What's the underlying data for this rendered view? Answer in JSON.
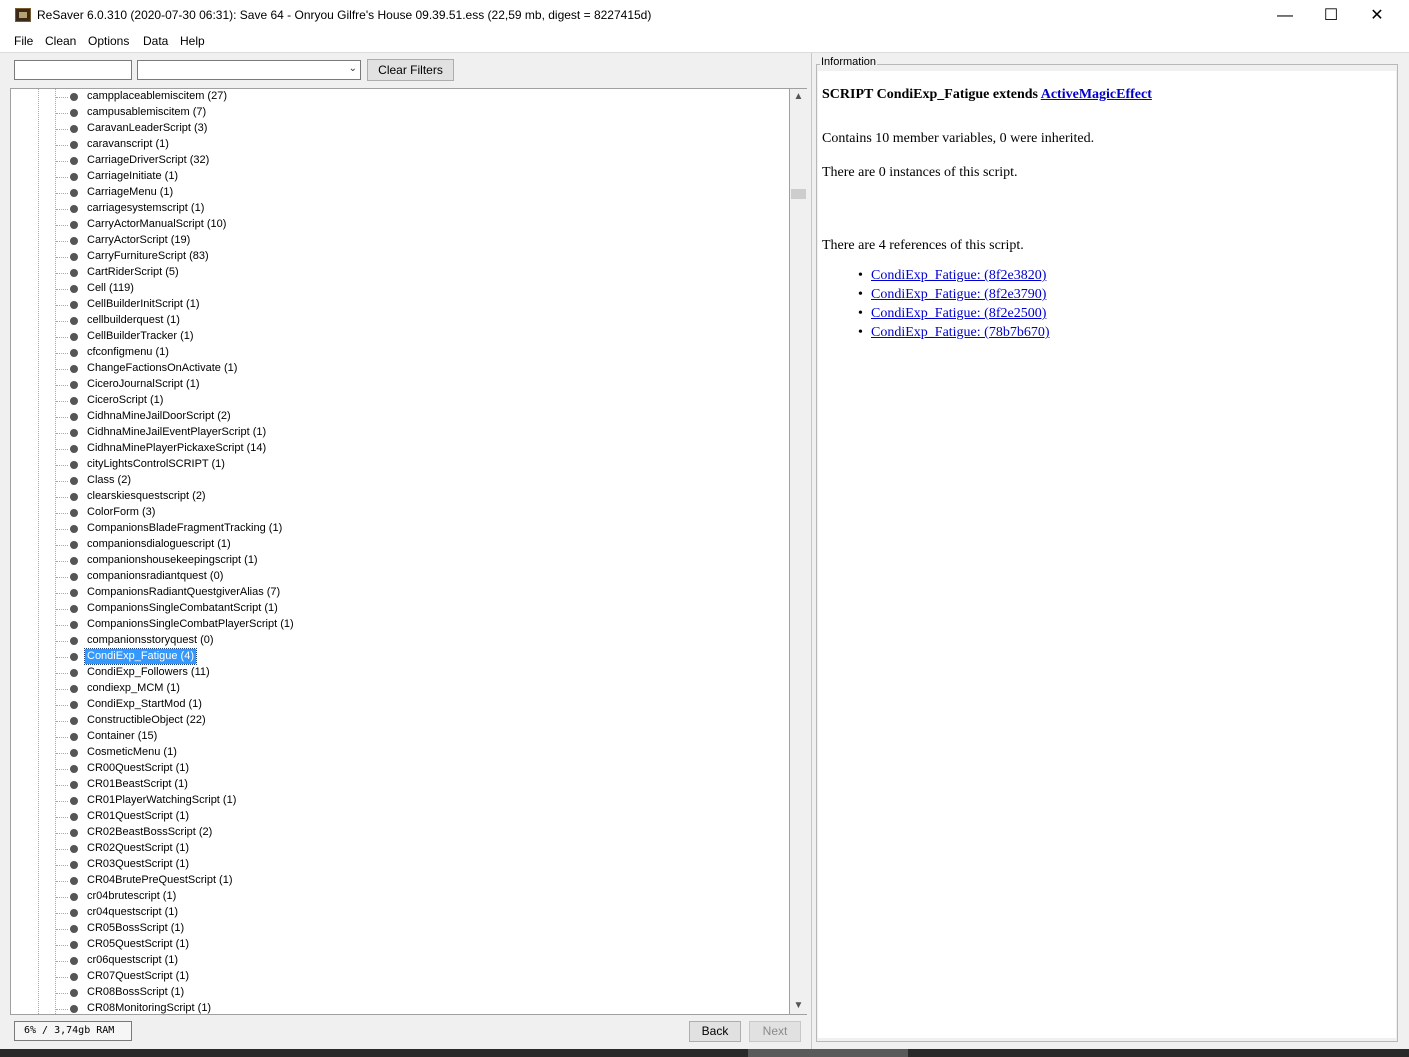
{
  "window": {
    "title": "ReSaver 6.0.310 (2020-07-30 06:31): Save 64 - Onryou  Gilfre's House  09.39.51.ess (22,59 mb, digest = 8227415d)",
    "minimize": "—",
    "maximize": "☐",
    "close": "✕"
  },
  "menu": [
    "File",
    "Clean",
    "Options",
    "Data",
    "Help"
  ],
  "filters": {
    "text_value": "",
    "select_value": "",
    "clear_label": "Clear Filters"
  },
  "tree": {
    "selected_index": 35,
    "items": [
      "campplaceablemiscitem (27)",
      "campusablemiscitem (7)",
      "CaravanLeaderScript (3)",
      "caravanscript (1)",
      "CarriageDriverScript (32)",
      "CarriageInitiate (1)",
      "CarriageMenu (1)",
      "carriagesystemscript (1)",
      "CarryActorManualScript (10)",
      "CarryActorScript (19)",
      "CarryFurnitureScript (83)",
      "CartRiderScript (5)",
      "Cell (119)",
      "CellBuilderInitScript (1)",
      "cellbuilderquest (1)",
      "CellBuilderTracker (1)",
      "cfconfigmenu (1)",
      "ChangeFactionsOnActivate (1)",
      "CiceroJournalScript (1)",
      "CiceroScript (1)",
      "CidhnaMineJailDoorScript (2)",
      "CidhnaMineJailEventPlayerScript (1)",
      "CidhnaMinePlayerPickaxeScript (14)",
      "cityLightsControlSCRIPT (1)",
      "Class (2)",
      "clearskiesquestscript (2)",
      "ColorForm (3)",
      "CompanionsBladeFragmentTracking (1)",
      "companionsdialoguescript (1)",
      "companionshousekeepingscript (1)",
      "companionsradiantquest (0)",
      "CompanionsRadiantQuestgiverAlias (7)",
      "CompanionsSingleCombatantScript (1)",
      "CompanionsSingleCombatPlayerScript (1)",
      "companionsstoryquest (0)",
      "CondiExp_Fatigue (4)",
      "CondiExp_Followers (11)",
      "condiexp_MCM (1)",
      "CondiExp_StartMod (1)",
      "ConstructibleObject (22)",
      "Container (15)",
      "CosmeticMenu (1)",
      "CR00QuestScript (1)",
      "CR01BeastScript (1)",
      "CR01PlayerWatchingScript (1)",
      "CR01QuestScript (1)",
      "CR02BeastBossScript (2)",
      "CR02QuestScript (1)",
      "CR03QuestScript (1)",
      "CR04BrutePreQuestScript (1)",
      "cr04brutescript (1)",
      "cr04questscript (1)",
      "CR05BossScript (1)",
      "CR05QuestScript (1)",
      "cr06questscript (1)",
      "CR07QuestScript (1)",
      "CR08BossScript (1)",
      "CR08MonitoringScript (1)"
    ]
  },
  "status": {
    "memory": "6% / 3,74gb RAM",
    "back_label": "Back",
    "next_label": "Next"
  },
  "info": {
    "legend": "Information",
    "heading_prefix": "SCRIPT CondiExp_Fatigue extends ",
    "heading_link": "ActiveMagicEffect",
    "members": "Contains 10 member variables, 0 were inherited.",
    "instances": "There are 0 instances of this script.",
    "references": "There are 4 references of this script.",
    "ref_links": [
      "CondiExp_Fatigue: (8f2e3820)",
      "CondiExp_Fatigue: (8f2e3790)",
      "CondiExp_Fatigue: (8f2e2500)",
      "CondiExp_Fatigue: (78b7b670)"
    ]
  }
}
